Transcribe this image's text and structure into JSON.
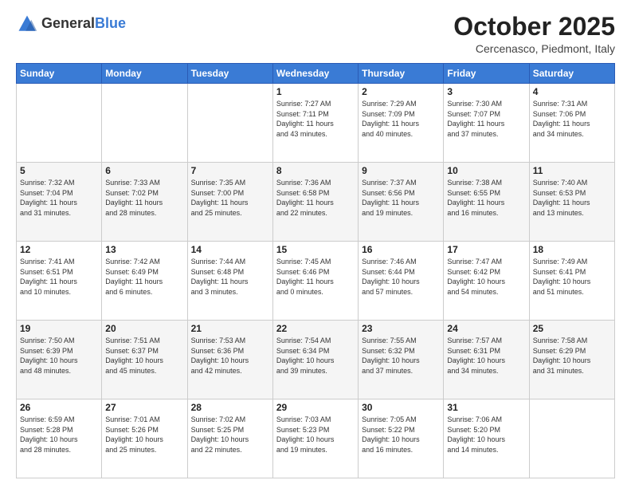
{
  "header": {
    "logo_general": "General",
    "logo_blue": "Blue",
    "month": "October 2025",
    "location": "Cercenasco, Piedmont, Italy"
  },
  "weekdays": [
    "Sunday",
    "Monday",
    "Tuesday",
    "Wednesday",
    "Thursday",
    "Friday",
    "Saturday"
  ],
  "weeks": [
    [
      {
        "day": "",
        "info": ""
      },
      {
        "day": "",
        "info": ""
      },
      {
        "day": "",
        "info": ""
      },
      {
        "day": "1",
        "info": "Sunrise: 7:27 AM\nSunset: 7:11 PM\nDaylight: 11 hours\nand 43 minutes."
      },
      {
        "day": "2",
        "info": "Sunrise: 7:29 AM\nSunset: 7:09 PM\nDaylight: 11 hours\nand 40 minutes."
      },
      {
        "day": "3",
        "info": "Sunrise: 7:30 AM\nSunset: 7:07 PM\nDaylight: 11 hours\nand 37 minutes."
      },
      {
        "day": "4",
        "info": "Sunrise: 7:31 AM\nSunset: 7:06 PM\nDaylight: 11 hours\nand 34 minutes."
      }
    ],
    [
      {
        "day": "5",
        "info": "Sunrise: 7:32 AM\nSunset: 7:04 PM\nDaylight: 11 hours\nand 31 minutes."
      },
      {
        "day": "6",
        "info": "Sunrise: 7:33 AM\nSunset: 7:02 PM\nDaylight: 11 hours\nand 28 minutes."
      },
      {
        "day": "7",
        "info": "Sunrise: 7:35 AM\nSunset: 7:00 PM\nDaylight: 11 hours\nand 25 minutes."
      },
      {
        "day": "8",
        "info": "Sunrise: 7:36 AM\nSunset: 6:58 PM\nDaylight: 11 hours\nand 22 minutes."
      },
      {
        "day": "9",
        "info": "Sunrise: 7:37 AM\nSunset: 6:56 PM\nDaylight: 11 hours\nand 19 minutes."
      },
      {
        "day": "10",
        "info": "Sunrise: 7:38 AM\nSunset: 6:55 PM\nDaylight: 11 hours\nand 16 minutes."
      },
      {
        "day": "11",
        "info": "Sunrise: 7:40 AM\nSunset: 6:53 PM\nDaylight: 11 hours\nand 13 minutes."
      }
    ],
    [
      {
        "day": "12",
        "info": "Sunrise: 7:41 AM\nSunset: 6:51 PM\nDaylight: 11 hours\nand 10 minutes."
      },
      {
        "day": "13",
        "info": "Sunrise: 7:42 AM\nSunset: 6:49 PM\nDaylight: 11 hours\nand 6 minutes."
      },
      {
        "day": "14",
        "info": "Sunrise: 7:44 AM\nSunset: 6:48 PM\nDaylight: 11 hours\nand 3 minutes."
      },
      {
        "day": "15",
        "info": "Sunrise: 7:45 AM\nSunset: 6:46 PM\nDaylight: 11 hours\nand 0 minutes."
      },
      {
        "day": "16",
        "info": "Sunrise: 7:46 AM\nSunset: 6:44 PM\nDaylight: 10 hours\nand 57 minutes."
      },
      {
        "day": "17",
        "info": "Sunrise: 7:47 AM\nSunset: 6:42 PM\nDaylight: 10 hours\nand 54 minutes."
      },
      {
        "day": "18",
        "info": "Sunrise: 7:49 AM\nSunset: 6:41 PM\nDaylight: 10 hours\nand 51 minutes."
      }
    ],
    [
      {
        "day": "19",
        "info": "Sunrise: 7:50 AM\nSunset: 6:39 PM\nDaylight: 10 hours\nand 48 minutes."
      },
      {
        "day": "20",
        "info": "Sunrise: 7:51 AM\nSunset: 6:37 PM\nDaylight: 10 hours\nand 45 minutes."
      },
      {
        "day": "21",
        "info": "Sunrise: 7:53 AM\nSunset: 6:36 PM\nDaylight: 10 hours\nand 42 minutes."
      },
      {
        "day": "22",
        "info": "Sunrise: 7:54 AM\nSunset: 6:34 PM\nDaylight: 10 hours\nand 39 minutes."
      },
      {
        "day": "23",
        "info": "Sunrise: 7:55 AM\nSunset: 6:32 PM\nDaylight: 10 hours\nand 37 minutes."
      },
      {
        "day": "24",
        "info": "Sunrise: 7:57 AM\nSunset: 6:31 PM\nDaylight: 10 hours\nand 34 minutes."
      },
      {
        "day": "25",
        "info": "Sunrise: 7:58 AM\nSunset: 6:29 PM\nDaylight: 10 hours\nand 31 minutes."
      }
    ],
    [
      {
        "day": "26",
        "info": "Sunrise: 6:59 AM\nSunset: 5:28 PM\nDaylight: 10 hours\nand 28 minutes."
      },
      {
        "day": "27",
        "info": "Sunrise: 7:01 AM\nSunset: 5:26 PM\nDaylight: 10 hours\nand 25 minutes."
      },
      {
        "day": "28",
        "info": "Sunrise: 7:02 AM\nSunset: 5:25 PM\nDaylight: 10 hours\nand 22 minutes."
      },
      {
        "day": "29",
        "info": "Sunrise: 7:03 AM\nSunset: 5:23 PM\nDaylight: 10 hours\nand 19 minutes."
      },
      {
        "day": "30",
        "info": "Sunrise: 7:05 AM\nSunset: 5:22 PM\nDaylight: 10 hours\nand 16 minutes."
      },
      {
        "day": "31",
        "info": "Sunrise: 7:06 AM\nSunset: 5:20 PM\nDaylight: 10 hours\nand 14 minutes."
      },
      {
        "day": "",
        "info": ""
      }
    ]
  ]
}
